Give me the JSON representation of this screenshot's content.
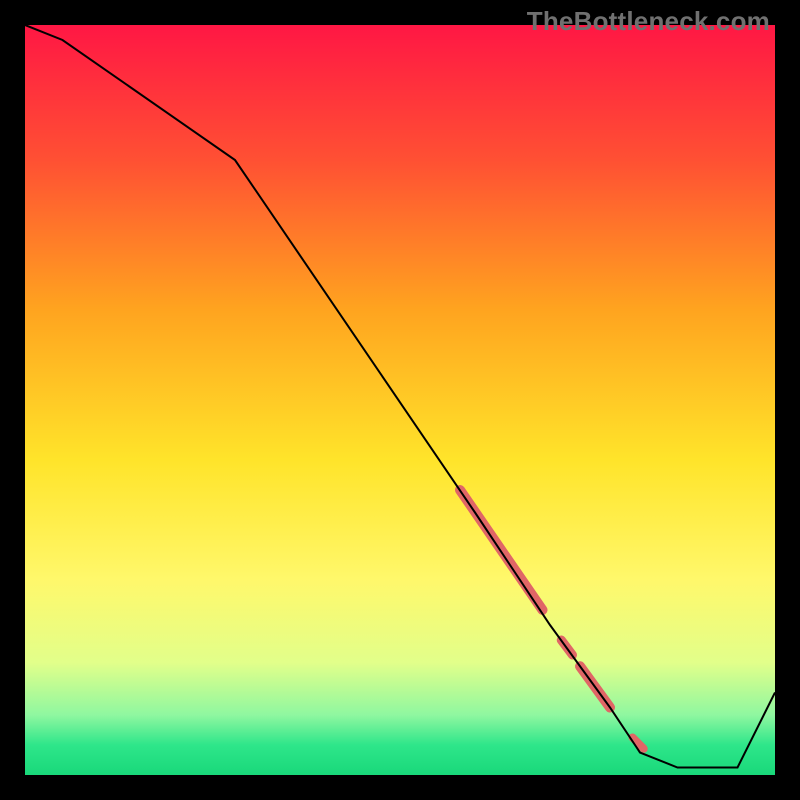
{
  "watermark": "TheBottleneck.com",
  "chart_data": {
    "type": "line",
    "title": "",
    "xlabel": "",
    "ylabel": "",
    "xlim": [
      0,
      100
    ],
    "ylim": [
      0,
      100
    ],
    "grid": false,
    "series": [
      {
        "name": "bottleneck-curve",
        "x": [
          0,
          5,
          28,
          60,
          70,
          78,
          82,
          87,
          95,
          100
        ],
        "y": [
          100,
          98,
          82,
          35,
          20,
          9,
          3,
          1,
          1,
          11
        ],
        "color": "#000000",
        "stroke_width": 2
      }
    ],
    "highlight_segments": [
      {
        "x0": 58,
        "y0": 38,
        "x1": 69,
        "y1": 22,
        "width": 10
      },
      {
        "x0": 71.5,
        "y0": 18,
        "x1": 73,
        "y1": 16,
        "width": 9
      },
      {
        "x0": 74,
        "y0": 14.5,
        "x1": 78,
        "y1": 9,
        "width": 10
      },
      {
        "x0": 81,
        "y0": 5,
        "x1": 82.5,
        "y1": 3.5,
        "width": 8
      }
    ],
    "highlight_color": "#e06666",
    "background_gradient": {
      "type": "vertical",
      "stops": [
        {
          "pct": 0,
          "color": "#ff1744"
        },
        {
          "pct": 18,
          "color": "#ff5033"
        },
        {
          "pct": 38,
          "color": "#ffa41f"
        },
        {
          "pct": 58,
          "color": "#ffe42a"
        },
        {
          "pct": 74,
          "color": "#fff86b"
        },
        {
          "pct": 85,
          "color": "#e2ff8a"
        },
        {
          "pct": 92,
          "color": "#8ff7a0"
        },
        {
          "pct": 96,
          "color": "#2ee68a"
        },
        {
          "pct": 100,
          "color": "#19d87a"
        }
      ]
    }
  }
}
